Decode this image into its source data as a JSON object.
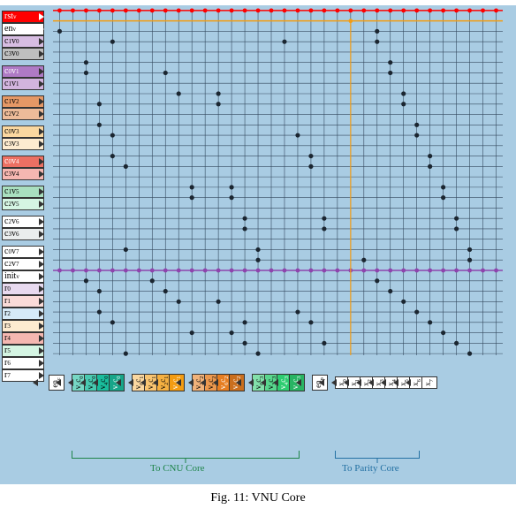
{
  "caption": "Fig. 11: VNU Core",
  "row_labels": [
    {
      "t": "rst",
      "sub": "v",
      "bg": "#ff0000",
      "fg": "#fff",
      "tri": "white"
    },
    {
      "t": "en",
      "sub": "v",
      "bg": "#ffffff",
      "fg": "#000",
      "tri": "white"
    },
    {
      "t": "c",
      "sub": "1",
      "t2": "v",
      "sub2": "0",
      "bg": "#d7bde2"
    },
    {
      "t": "c",
      "sub": "3",
      "t2": "v",
      "sub2": "0",
      "bg": "#bfbfbf"
    },
    {
      "gap": true
    },
    {
      "t": "c",
      "sub": "0",
      "t2": "v",
      "sub2": "1",
      "bg": "#af7ac5",
      "fg": "#fff"
    },
    {
      "t": "c",
      "sub": "1",
      "t2": "v",
      "sub2": "1",
      "bg": "#d2b4de"
    },
    {
      "gap": true
    },
    {
      "t": "c",
      "sub": "1",
      "t2": "v",
      "sub2": "2",
      "bg": "#e59866"
    },
    {
      "t": "c",
      "sub": "2",
      "t2": "v",
      "sub2": "2",
      "bg": "#edbb99"
    },
    {
      "gap": true
    },
    {
      "t": "c",
      "sub": "0",
      "t2": "v",
      "sub2": "3",
      "bg": "#fad7a0"
    },
    {
      "t": "c",
      "sub": "3",
      "t2": "v",
      "sub2": "3",
      "bg": "#fdebd0"
    },
    {
      "gap": true
    },
    {
      "t": "c",
      "sub": "0",
      "t2": "v",
      "sub2": "4",
      "bg": "#ec7063",
      "fg": "#fff"
    },
    {
      "t": "c",
      "sub": "3",
      "t2": "v",
      "sub2": "4",
      "bg": "#f5b7b1"
    },
    {
      "gap": true
    },
    {
      "t": "c",
      "sub": "1",
      "t2": "v",
      "sub2": "5",
      "bg": "#a9dfbf"
    },
    {
      "t": "c",
      "sub": "2",
      "t2": "v",
      "sub2": "5",
      "bg": "#d5f5e3"
    },
    {
      "gap": true
    },
    {
      "t": "c",
      "sub": "2",
      "t2": "v",
      "sub2": "6",
      "bg": "#ffffff"
    },
    {
      "t": "c",
      "sub": "3",
      "t2": "v",
      "sub2": "6",
      "bg": "#eaeded"
    },
    {
      "gap": true
    },
    {
      "t": "c",
      "sub": "0",
      "t2": "v",
      "sub2": "7",
      "bg": "#ffffff"
    },
    {
      "t": "c",
      "sub": "2",
      "t2": "v",
      "sub2": "7",
      "bg": "#ffffff"
    },
    {
      "t": "init",
      "sub": "v",
      "bg": "#ffffff"
    },
    {
      "t": "r",
      "sub": "0",
      "bg": "#e8daef"
    },
    {
      "t": "r",
      "sub": "1",
      "bg": "#fadbd8"
    },
    {
      "t": "r",
      "sub": "2",
      "bg": "#d6eaf8"
    },
    {
      "t": "r",
      "sub": "3",
      "bg": "#fdebd0"
    },
    {
      "t": "r",
      "sub": "4",
      "bg": "#f5b7b1"
    },
    {
      "t": "r",
      "sub": "5",
      "bg": "#d5f5e3"
    },
    {
      "t": "r",
      "sub": "6",
      "bg": "#ffffff"
    },
    {
      "t": "r",
      "sub": "7",
      "bg": "#ffffff"
    }
  ],
  "col_labels": [
    {
      "t": "en",
      "sub": "c",
      "bg": "#ffffff"
    },
    {
      "gap": true
    },
    {
      "t": "v",
      "sub": "1",
      "t2": "c",
      "sub2": "0",
      "bg": "#76d7c4"
    },
    {
      "t": "v",
      "sub": "3",
      "t2": "c",
      "sub2": "0",
      "bg": "#48c9b0"
    },
    {
      "t": "v",
      "sub": "4",
      "t2": "c",
      "sub2": "0",
      "bg": "#1abc9c"
    },
    {
      "t": "v",
      "sub": "7",
      "t2": "c",
      "sub2": "0",
      "bg": "#17a589",
      "fg": "#fff"
    },
    {
      "gap": true
    },
    {
      "t": "v",
      "sub": "0",
      "t2": "c",
      "sub2": "1",
      "bg": "#fad7a0"
    },
    {
      "t": "v",
      "sub": "1",
      "t2": "c",
      "sub2": "1",
      "bg": "#f8c471"
    },
    {
      "t": "v",
      "sub": "2",
      "t2": "c",
      "sub2": "1",
      "bg": "#f5b041"
    },
    {
      "t": "v",
      "sub": "5",
      "t2": "c",
      "sub2": "1",
      "bg": "#f39c12",
      "fg": "#fff"
    },
    {
      "gap": true
    },
    {
      "t": "v",
      "sub": "2",
      "t2": "c",
      "sub2": "2",
      "bg": "#f0b27a"
    },
    {
      "t": "v",
      "sub": "5",
      "t2": "c",
      "sub2": "2",
      "bg": "#eb984e"
    },
    {
      "t": "v",
      "sub": "6",
      "t2": "c",
      "sub2": "2",
      "bg": "#e67e22",
      "fg": "#fff"
    },
    {
      "t": "v",
      "sub": "7",
      "t2": "c",
      "sub2": "2",
      "bg": "#ca6f1e",
      "fg": "#fff"
    },
    {
      "gap": true
    },
    {
      "t": "v",
      "sub": "0",
      "t2": "c",
      "sub2": "3",
      "bg": "#82e0aa"
    },
    {
      "t": "v",
      "sub": "3",
      "t2": "c",
      "sub2": "3",
      "bg": "#58d68d"
    },
    {
      "t": "v",
      "sub": "4",
      "t2": "c",
      "sub2": "3",
      "bg": "#2ecc71",
      "fg": "#fff"
    },
    {
      "t": "v",
      "sub": "6",
      "t2": "c",
      "sub2": "3",
      "bg": "#28b463",
      "fg": "#fff"
    },
    {
      "gap": true
    },
    {
      "t": "en",
      "sub": "p",
      "bg": "#ffffff"
    },
    {
      "gap": true
    },
    {
      "t": "x",
      "sub": "0",
      "bg": "#ffffff"
    },
    {
      "t": "x",
      "sub": "1",
      "bg": "#ffffff"
    },
    {
      "t": "x",
      "sub": "2",
      "bg": "#ffffff"
    },
    {
      "t": "x",
      "sub": "3",
      "bg": "#ffffff"
    },
    {
      "t": "x",
      "sub": "4",
      "bg": "#ffffff"
    },
    {
      "t": "x",
      "sub": "5",
      "bg": "#ffffff"
    },
    {
      "t": "x",
      "sub": "6",
      "bg": "#ffffff"
    },
    {
      "t": "x",
      "sub": "7",
      "bg": "#ffffff"
    }
  ],
  "braces": [
    {
      "label": "To CNU Core",
      "color": "#1e8449",
      "left_col": 1,
      "right_col": 20
    },
    {
      "label": "To Parity Core",
      "color": "#2471a3",
      "left_col": 23,
      "right_col": 30
    }
  ],
  "grid": {
    "rows": 33,
    "cols": 34,
    "lines": {
      "rst": {
        "row": 0,
        "color": "#ff0000",
        "dots_all": true
      },
      "en": {
        "row": 1,
        "color": "#f39c12",
        "dot_col": 22
      },
      "init": {
        "row": 25,
        "color": "#8e44ad",
        "dots_all": true
      }
    },
    "dots": [
      [
        2,
        0
      ],
      [
        3,
        4
      ],
      [
        3,
        17
      ],
      [
        5,
        2
      ],
      [
        6,
        8
      ],
      [
        8,
        9
      ],
      [
        8,
        12
      ],
      [
        9,
        12
      ],
      [
        11,
        3
      ],
      [
        12,
        18
      ],
      [
        14,
        4
      ],
      [
        14,
        19
      ],
      [
        15,
        19
      ],
      [
        17,
        10
      ],
      [
        17,
        13
      ],
      [
        18,
        13
      ],
      [
        20,
        14
      ],
      [
        20,
        20
      ],
      [
        21,
        20
      ],
      [
        23,
        5
      ],
      [
        23,
        15
      ],
      [
        24,
        15
      ],
      [
        26,
        7
      ],
      [
        26,
        24
      ],
      [
        27,
        8
      ],
      [
        27,
        25
      ],
      [
        28,
        9
      ],
      [
        28,
        26
      ],
      [
        29,
        3
      ],
      [
        29,
        27
      ],
      [
        30,
        4
      ],
      [
        30,
        19
      ],
      [
        30,
        28
      ],
      [
        31,
        13
      ],
      [
        31,
        29
      ],
      [
        32,
        14
      ],
      [
        32,
        30
      ],
      [
        33,
        5
      ],
      [
        33,
        31
      ],
      [
        2,
        24
      ],
      [
        3,
        24
      ],
      [
        5,
        25
      ],
      [
        6,
        25
      ],
      [
        8,
        26
      ],
      [
        9,
        26
      ],
      [
        11,
        27
      ],
      [
        12,
        27
      ],
      [
        14,
        28
      ],
      [
        15,
        28
      ],
      [
        17,
        29
      ],
      [
        18,
        29
      ],
      [
        20,
        30
      ],
      [
        21,
        30
      ],
      [
        23,
        31
      ],
      [
        24,
        31
      ],
      [
        6,
        2
      ],
      [
        9,
        3
      ],
      [
        12,
        4
      ],
      [
        15,
        5
      ],
      [
        18,
        10
      ],
      [
        21,
        14
      ],
      [
        24,
        23
      ],
      [
        26,
        2
      ],
      [
        27,
        3
      ],
      [
        28,
        12
      ],
      [
        29,
        18
      ],
      [
        30,
        14
      ],
      [
        31,
        10
      ],
      [
        32,
        20
      ],
      [
        33,
        15
      ]
    ]
  }
}
